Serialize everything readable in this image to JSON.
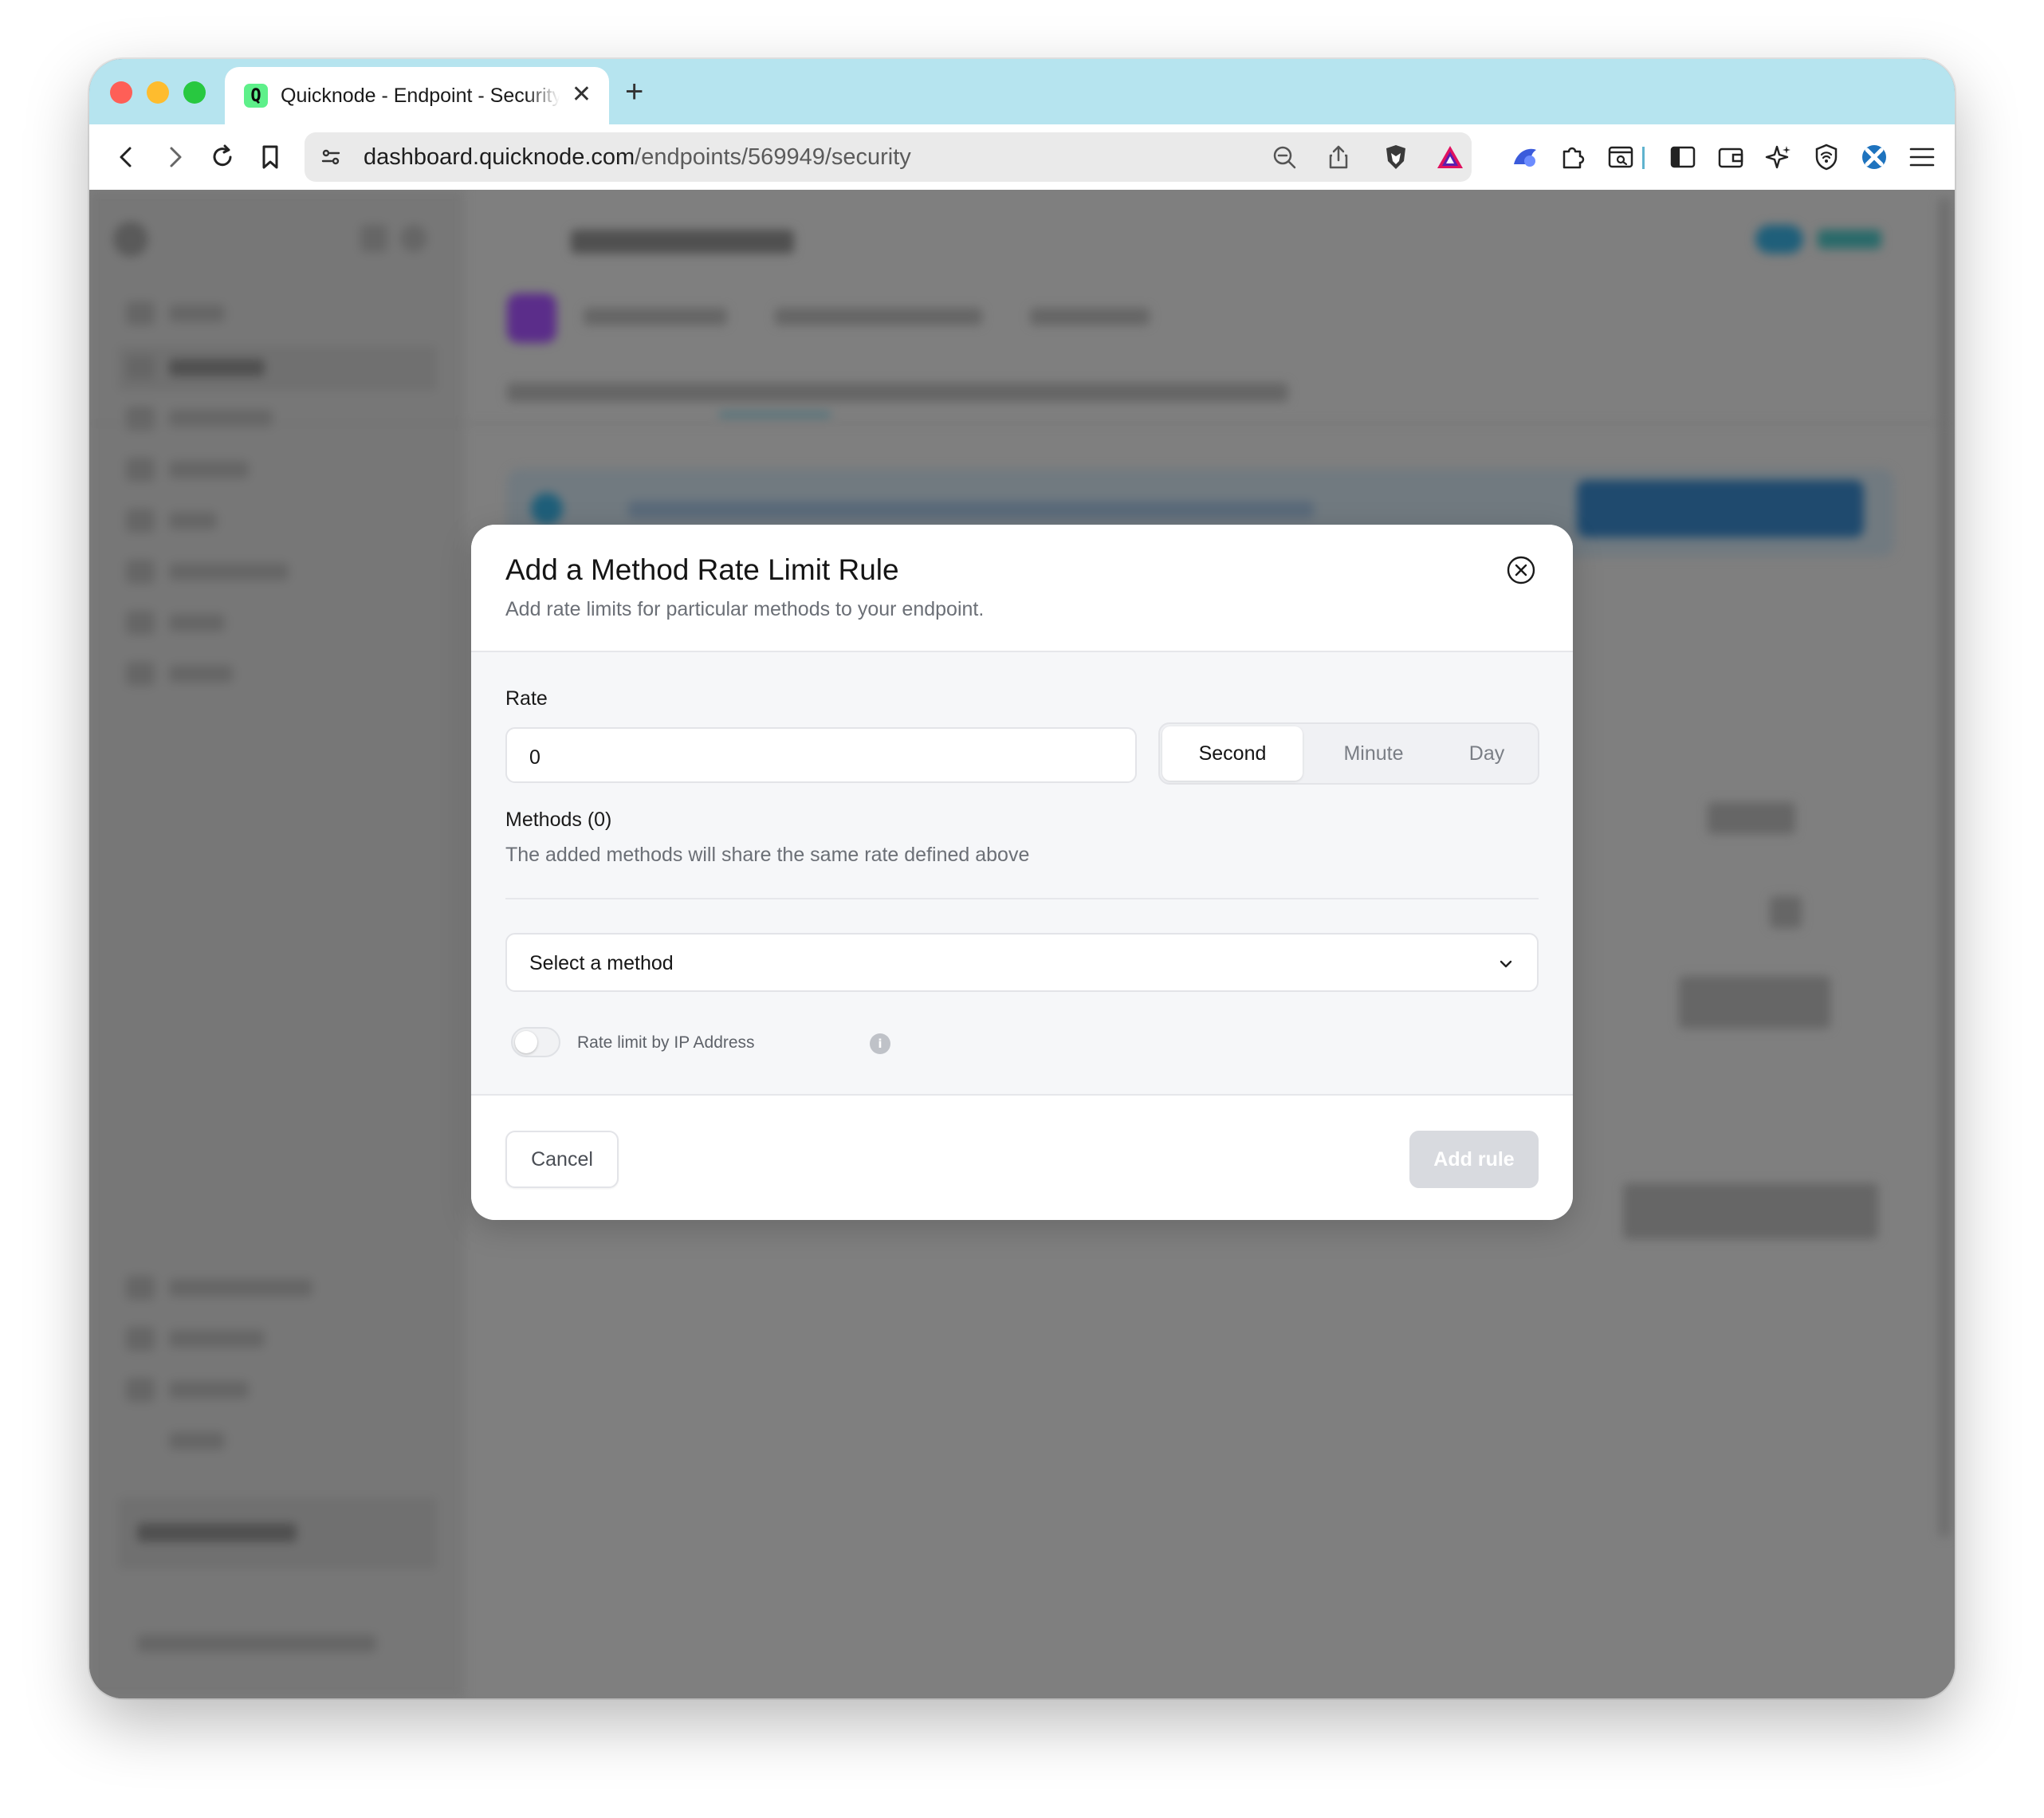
{
  "browser": {
    "tab_title": "Quicknode - Endpoint - Security",
    "favicon_letter": "Q",
    "url_host": "dashboard.quicknode.com",
    "url_path": "/endpoints/569949/security"
  },
  "modal": {
    "title": "Add a Method Rate Limit Rule",
    "subtitle": "Add rate limits for particular methods to your endpoint.",
    "rate_label": "Rate",
    "rate_value": "0",
    "units": [
      "Second",
      "Minute",
      "Day"
    ],
    "selected_unit": "Second",
    "methods_label": "Methods (0)",
    "methods_help": "The added methods will share the same rate defined above",
    "select_placeholder": "Select a method",
    "ip_toggle_label": "Rate limit by IP Address",
    "ip_toggle_on": false,
    "info_glyph": "i",
    "cancel_label": "Cancel",
    "add_label": "Add rule",
    "add_enabled": false
  },
  "colors": {
    "tab_strip": "#b6e4ef",
    "favicon": "#5ef08a",
    "dim_background": "#7f7f7f",
    "disabled_button": "#d8dadf"
  },
  "icons": [
    "back-icon",
    "forward-icon",
    "reload-icon",
    "bookmark-icon",
    "site-settings-icon",
    "zoom-out-icon",
    "share-icon",
    "brave-shield-icon",
    "brave-rewards-icon",
    "extension-icon",
    "puzzle-icon",
    "reader-icon",
    "sidebar-icon",
    "wallet-icon",
    "leo-icon",
    "vpn-icon",
    "app-icon",
    "menu-icon",
    "close-icon",
    "chevron-down-icon",
    "info-icon"
  ]
}
